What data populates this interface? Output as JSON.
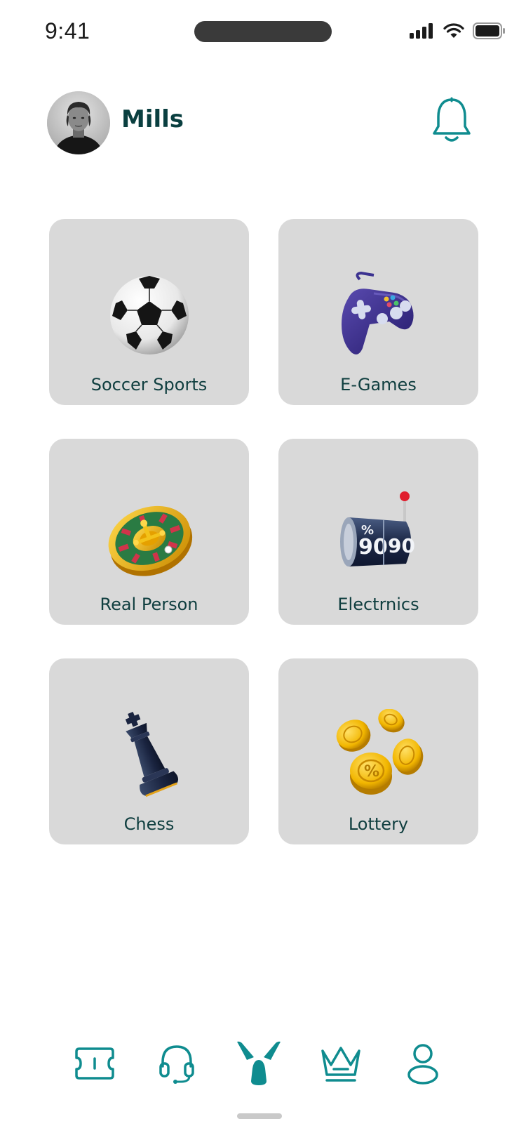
{
  "status_bar": {
    "time": "9:41",
    "icons": [
      "cellular-signal-icon",
      "wifi-icon",
      "battery-icon"
    ]
  },
  "header": {
    "user_name": "Mills",
    "avatar": "user-avatar",
    "notification_icon": "bell-icon"
  },
  "categories": [
    {
      "label": "Soccer Sports",
      "icon": "soccer-ball-icon"
    },
    {
      "label": "E-Games",
      "icon": "gamepad-icon"
    },
    {
      "label": "Real Person",
      "icon": "roulette-wheel-icon"
    },
    {
      "label": "Electrnics",
      "icon": "slot-machine-icon"
    },
    {
      "label": "Chess",
      "icon": "chess-king-icon"
    },
    {
      "label": "Lottery",
      "icon": "gold-coins-icon"
    }
  ],
  "bottom_nav": {
    "items": [
      {
        "icon": "ticket-icon",
        "active": false
      },
      {
        "icon": "headset-icon",
        "active": false
      },
      {
        "icon": "home-logo-icon",
        "active": true
      },
      {
        "icon": "crown-icon",
        "active": false
      },
      {
        "icon": "profile-icon",
        "active": false
      }
    ]
  },
  "colors": {
    "accent": "#0f8c8f",
    "text_dark": "#0a3f40",
    "card_bg": "#d9d9d9"
  }
}
